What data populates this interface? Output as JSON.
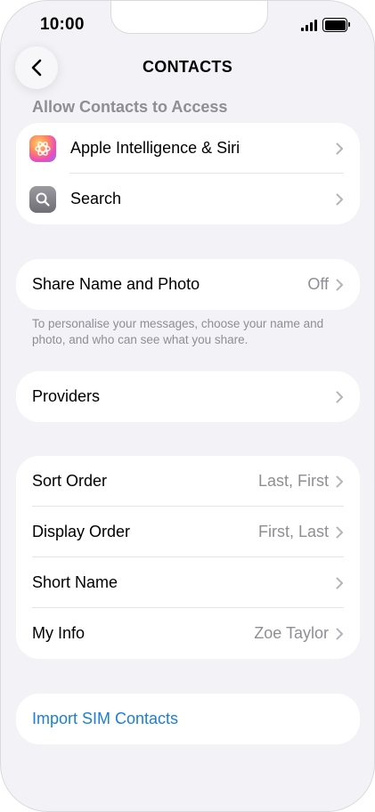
{
  "status_bar": {
    "time": "10:00"
  },
  "nav": {
    "title": "CONTACTS"
  },
  "access": {
    "header": "Allow Contacts to Access",
    "items": [
      {
        "label": "Apple Intelligence & Siri",
        "icon": "apple-intelligence-icon"
      },
      {
        "label": "Search",
        "icon": "search-icon"
      }
    ]
  },
  "share": {
    "label": "Share Name and Photo",
    "value": "Off",
    "footer": "To personalise your messages, choose your name and photo, and who can see what you share."
  },
  "providers": {
    "label": "Providers"
  },
  "display": {
    "items": [
      {
        "label": "Sort Order",
        "value": "Last, First"
      },
      {
        "label": "Display Order",
        "value": "First, Last"
      },
      {
        "label": "Short Name",
        "value": ""
      },
      {
        "label": "My Info",
        "value": "Zoe Taylor"
      }
    ]
  },
  "import": {
    "label": "Import SIM Contacts"
  },
  "colors": {
    "link": "#1a7fd6",
    "secondary_text": "#8e8e93",
    "background": "#f2f2f7"
  }
}
